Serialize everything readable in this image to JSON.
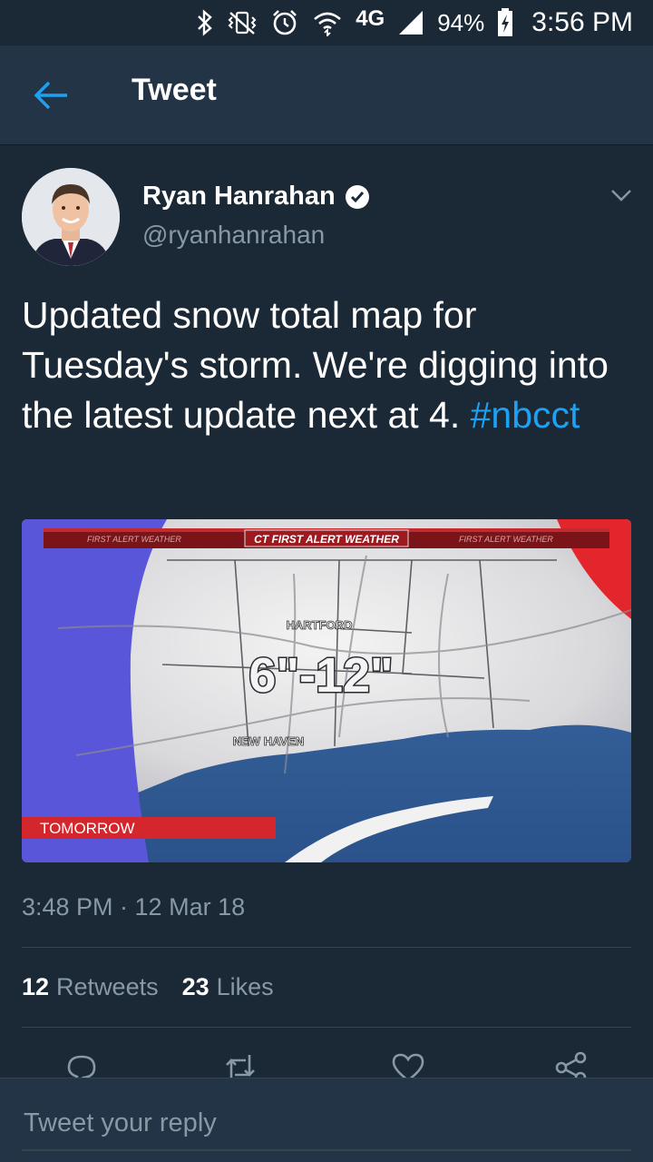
{
  "status_bar": {
    "network": "4G",
    "battery_percent": "94%",
    "time": "3:56 PM",
    "icons": [
      "bluetooth-icon",
      "mute-vibrate-icon",
      "alarm-icon",
      "wifi-icon",
      "4g-lte-icon",
      "signal-icon",
      "battery-charging-icon"
    ]
  },
  "header": {
    "title": "Tweet",
    "back_icon": "back-arrow-icon"
  },
  "tweet": {
    "author_name": "Ryan Hanrahan",
    "author_handle": "@ryanhanrahan",
    "verified": true,
    "text": "Updated snow total map for Tuesday's storm. We're digging into the latest update next at 4. ",
    "hashtag": "#nbcct",
    "timestamp": "3:48 PM · 12 Mar 18",
    "retweets_count": "12",
    "retweets_label": "Retweets",
    "likes_count": "23",
    "likes_label": "Likes"
  },
  "media": {
    "banner": "CT FIRST ALERT WEATHER",
    "banner_side_left": "FIRST ALERT WEATHER",
    "banner_side_right": "FIRST ALERT WEATHER",
    "city_1": "HARTFORD",
    "city_2": "NEW HAVEN",
    "snow_total": "6\"-12\"",
    "tag": "TOMORROW"
  },
  "actions": [
    "reply-icon",
    "retweet-icon",
    "like-icon",
    "share-icon"
  ],
  "reply": {
    "placeholder": "Tweet your reply"
  },
  "colors": {
    "background": "#1b2836",
    "header_bg": "#243447",
    "accent": "#1da1f2",
    "muted_text": "#8899a6"
  }
}
